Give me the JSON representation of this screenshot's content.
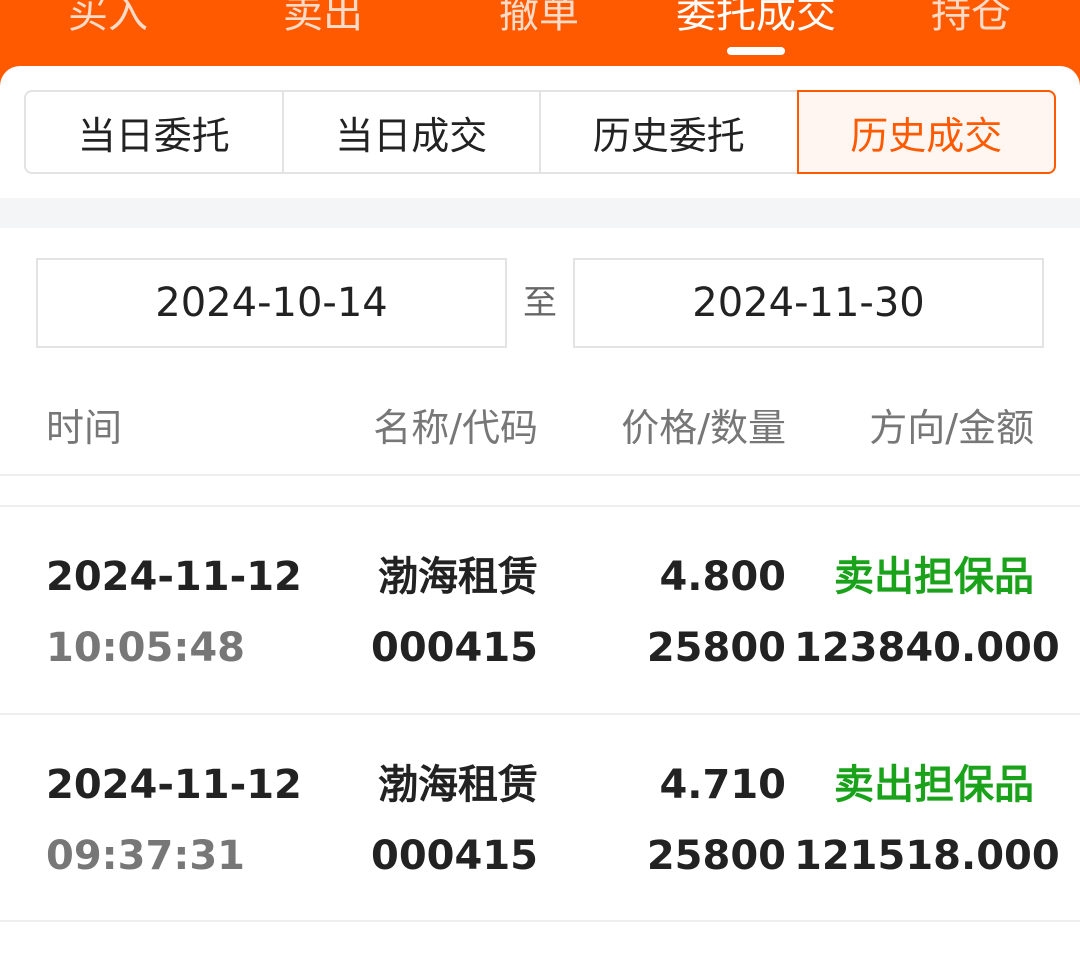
{
  "top_nav": {
    "tabs": [
      {
        "label": "买入"
      },
      {
        "label": "卖出"
      },
      {
        "label": "撤单"
      },
      {
        "label": "委托成交"
      },
      {
        "label": "持仓"
      }
    ],
    "active_tab": "委托成交"
  },
  "segments": {
    "items": [
      {
        "label": "当日委托"
      },
      {
        "label": "当日成交"
      },
      {
        "label": "历史委托"
      },
      {
        "label": "历史成交"
      }
    ],
    "active": "历史成交"
  },
  "date_range": {
    "start": "2024-10-14",
    "separator": "至",
    "end": "2024-11-30"
  },
  "table": {
    "headers": {
      "time": "时间",
      "name_code": "名称/代码",
      "price_qty": "价格/数量",
      "direction_amount": "方向/金额"
    },
    "rows": [
      {
        "date": "2024-11-12",
        "time": "10:05:48",
        "name": "渤海租赁",
        "code": "000415",
        "price": "4.800",
        "quantity": "25800",
        "direction": "卖出担保品",
        "amount": "123840.000"
      },
      {
        "date": "2024-11-12",
        "time": "09:37:31",
        "name": "渤海租赁",
        "code": "000415",
        "price": "4.710",
        "quantity": "25800",
        "direction": "卖出担保品",
        "amount": "121518.000"
      }
    ]
  },
  "colors": {
    "brand_orange": "#ff5a00",
    "sell_green": "#1aa31a"
  }
}
